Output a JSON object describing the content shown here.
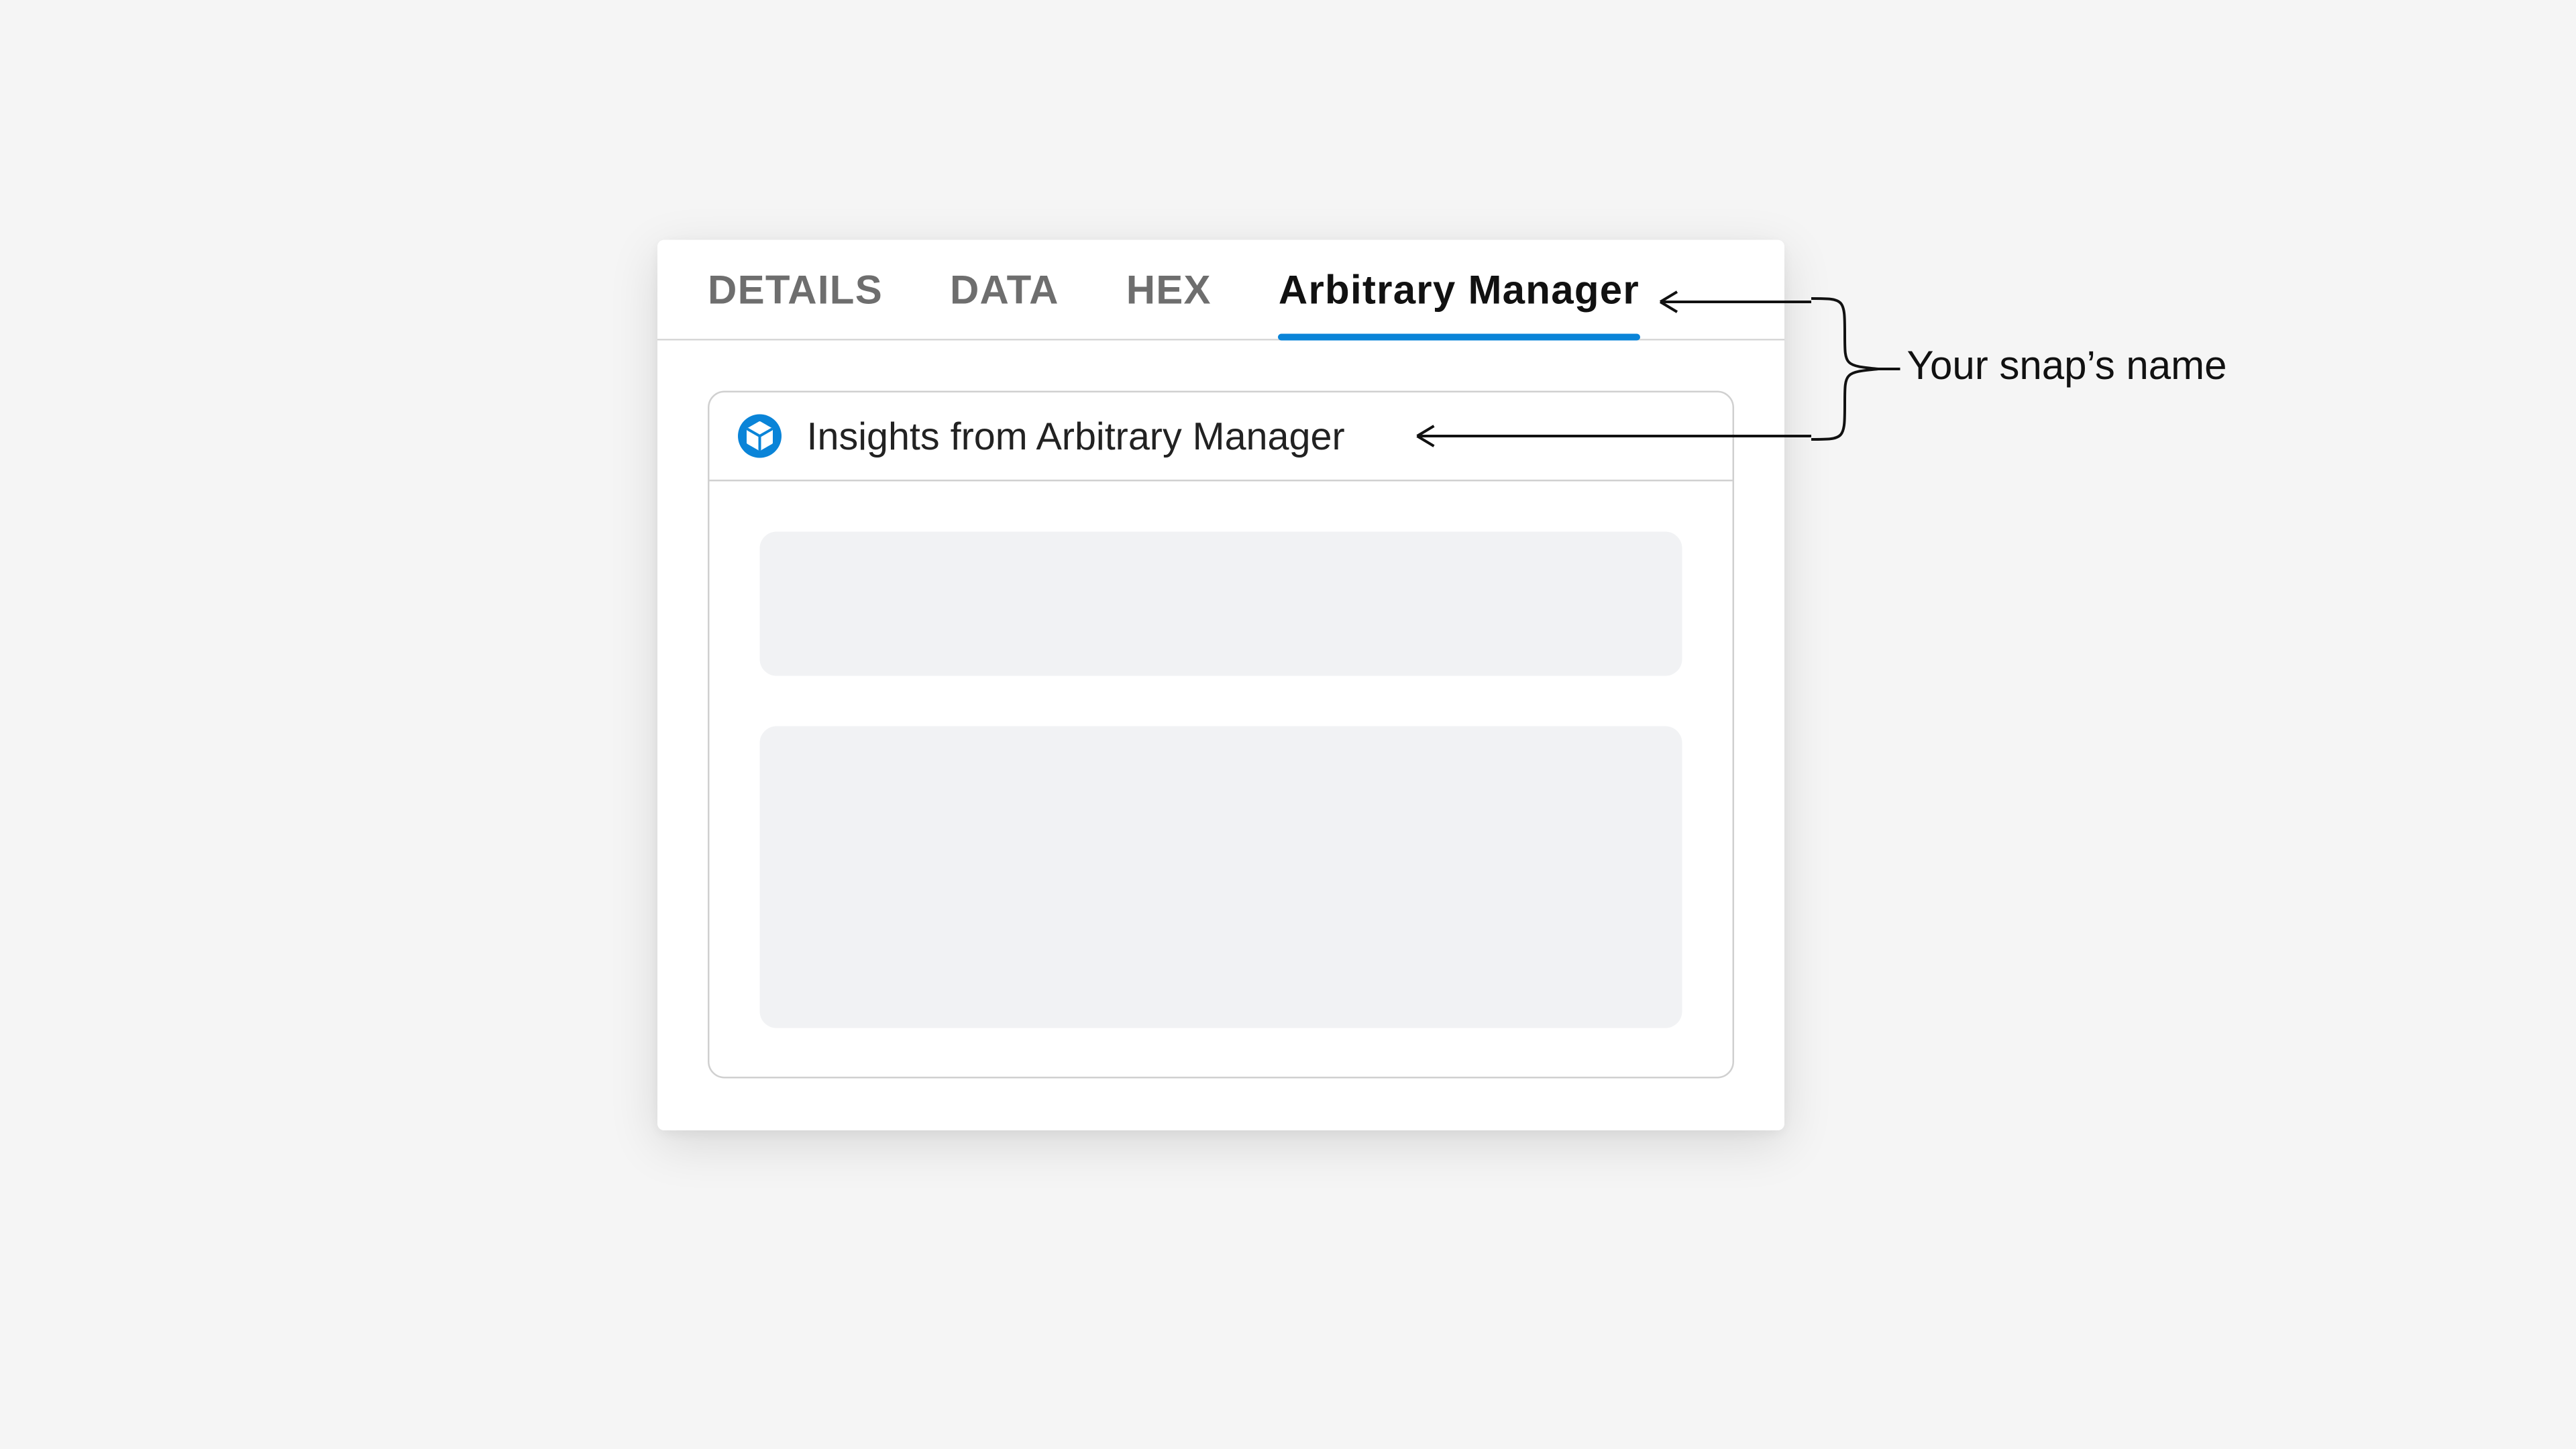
{
  "tabs": {
    "details": "DETAILS",
    "data": "DATA",
    "hex": "HEX",
    "arbitrary": "Arbitrary Manager"
  },
  "panel": {
    "title": "Insights from Arbitrary Manager",
    "icon": "cube-icon"
  },
  "annotation": {
    "label": "Your snap’s name"
  },
  "colors": {
    "accent": "#0a84d8",
    "tab_inactive": "#6e6e6e",
    "border": "#d0d0d0",
    "placeholder": "#f1f2f4",
    "page_bg": "#f5f5f5",
    "card_bg": "#ffffff"
  }
}
